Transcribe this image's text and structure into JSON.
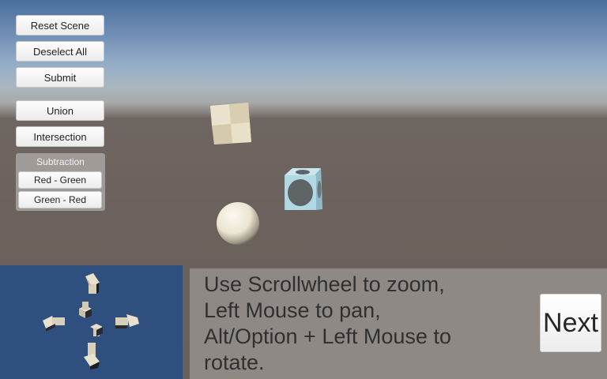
{
  "toolbar": {
    "reset_label": "Reset Scene",
    "deselect_label": "Deselect All",
    "submit_label": "Submit",
    "union_label": "Union",
    "intersection_label": "Intersection"
  },
  "subtraction": {
    "title": "Subtraction",
    "red_green_label": "Red - Green",
    "green_red_label": "Green - Red"
  },
  "instructions": {
    "lines": [
      "Use Scrollwheel to zoom,",
      "Left Mouse to pan,",
      "Alt/Option + Left Mouse to",
      "rotate."
    ]
  },
  "navigation": {
    "next_label": "Next"
  },
  "scene": {
    "objects": [
      "cube",
      "hollow-cube",
      "sphere"
    ],
    "colors": {
      "sky": "#6d8cb4",
      "ground": "#6c625d",
      "cube": "#e6dcc4",
      "hollow_cube": "#a9d3df",
      "sphere": "#f1ecda",
      "minimap": "#2f4f7f",
      "instruction_panel": "#8f8986"
    }
  },
  "minimap": {
    "icons": [
      "arrow-up-icon",
      "arrow-down-icon",
      "arrow-left-icon",
      "arrow-right-icon",
      "center-gizmo-icon"
    ]
  }
}
